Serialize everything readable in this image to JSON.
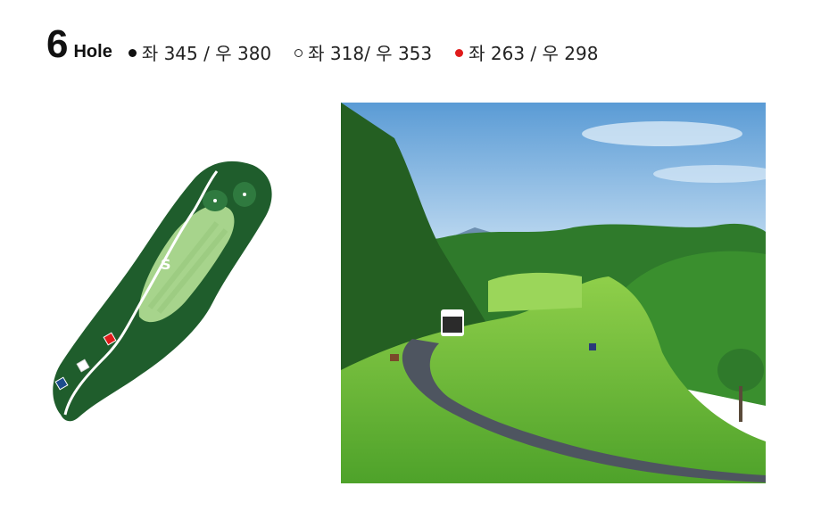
{
  "hole": {
    "number": "6",
    "label": "Hole"
  },
  "tees": [
    {
      "marker": "black-filled-dot",
      "text": "좌 345 / 우 380"
    },
    {
      "marker": "white-hollow-dot",
      "text": "좌 318/ 우 353"
    },
    {
      "marker": "red-filled-dot",
      "text": "좌 263 / 우 298"
    }
  ],
  "colors": {
    "red_tee": "#e01b1b",
    "fairway": "#1f5d2c",
    "green": "#a7d48c",
    "blue_tee": "#1c4c8c"
  }
}
